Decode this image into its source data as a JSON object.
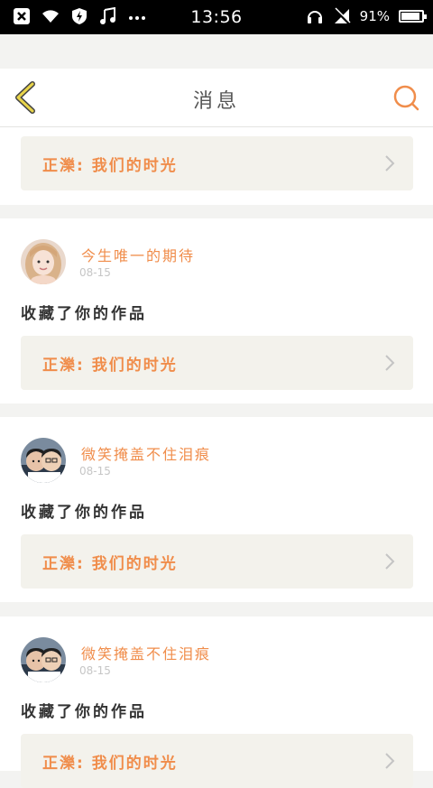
{
  "status_bar": {
    "time": "13:56",
    "battery": "91%",
    "battery_level": 0.91
  },
  "header": {
    "title": "消息",
    "back_icon": "back-chevron-icon",
    "search_icon": "search-icon"
  },
  "top_card": {
    "quote": "正濼: 我们的时光"
  },
  "messages": [
    {
      "username": "今生唯一的期待",
      "date": "08-15",
      "action": "收藏了你的作品",
      "quote": "正濼: 我们的时光"
    },
    {
      "username": "微笑掩盖不住泪痕",
      "date": "08-15",
      "action": "收藏了你的作品",
      "quote": "正濼: 我们的时光"
    },
    {
      "username": "微笑掩盖不住泪痕",
      "date": "08-15",
      "action": "收藏了你的作品",
      "quote": "正濼: 我们的时光"
    }
  ],
  "colors": {
    "accent": "#f08d4b",
    "back": "#e8d44a",
    "quote_bg": "#f3f2ec",
    "page_bg": "#f3f3f1"
  }
}
